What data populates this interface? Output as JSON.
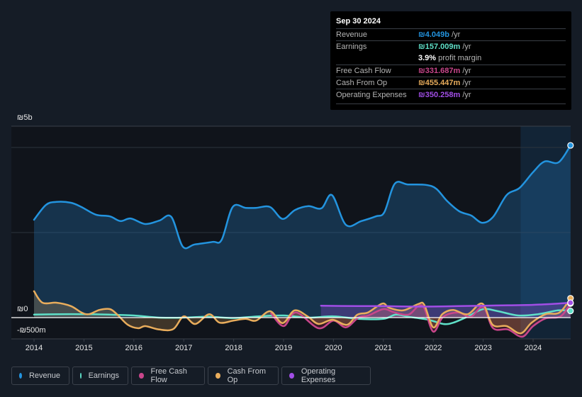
{
  "tooltip": {
    "date": "Sep 30 2024",
    "rows": [
      {
        "label": "Revenue",
        "value": "₪4.049b",
        "suffix": " /yr",
        "color": "#2394df"
      },
      {
        "label": "Earnings",
        "value": "₪157.009m",
        "suffix": " /yr",
        "color": "#5fe0c8"
      },
      {
        "label": "",
        "value": "3.9%",
        "suffix": " profit margin",
        "color": "#ffffff"
      },
      {
        "label": "Free Cash Flow",
        "value": "₪331.687m",
        "suffix": " /yr",
        "color": "#c9468b"
      },
      {
        "label": "Cash From Op",
        "value": "₪455.447m",
        "suffix": " /yr",
        "color": "#e9ad5c"
      },
      {
        "label": "Operating Expenses",
        "value": "₪350.258m",
        "suffix": " /yr",
        "color": "#a14ee6"
      }
    ]
  },
  "legend": [
    {
      "label": "Revenue",
      "color": "#2394df"
    },
    {
      "label": "Earnings",
      "color": "#5fe0c8"
    },
    {
      "label": "Free Cash Flow",
      "color": "#c9468b"
    },
    {
      "label": "Cash From Op",
      "color": "#e9ad5c"
    },
    {
      "label": "Operating Expenses",
      "color": "#a14ee6"
    }
  ],
  "chart_data": {
    "type": "line",
    "title": "",
    "xlabel": "",
    "ylabel": "",
    "y_unit": "billions ILS (₪)",
    "ylim": [
      -0.5,
      4.5
    ],
    "y_tick_labels": [
      "₪5b",
      "₪0",
      "-₪500m"
    ],
    "y_ticks": [
      5,
      0,
      -0.5
    ],
    "gridlines": [
      2,
      4
    ],
    "x_tick_labels": [
      "2014",
      "2015",
      "2016",
      "2017",
      "2018",
      "2019",
      "2020",
      "2021",
      "2022",
      "2023",
      "2024"
    ],
    "x_ticks": [
      2014,
      2015,
      2016,
      2017,
      2018,
      2019,
      2020,
      2021,
      2022,
      2023,
      2024
    ],
    "xlim": [
      2014,
      2024.75
    ],
    "highlight_from": 2023.75,
    "legend_position": "bottom-left",
    "series": [
      {
        "name": "Revenue",
        "color": "#2394df",
        "fill": true,
        "x": [
          2014.0,
          2014.24,
          2014.45,
          2014.74,
          2014.95,
          2015.24,
          2015.52,
          2015.73,
          2015.94,
          2016.23,
          2016.51,
          2016.75,
          2016.98,
          2017.22,
          2017.58,
          2017.76,
          2017.98,
          2018.24,
          2018.45,
          2018.73,
          2018.98,
          2019.23,
          2019.5,
          2019.76,
          2019.97,
          2020.25,
          2020.56,
          2020.85,
          2021.02,
          2021.23,
          2021.49,
          2021.85,
          2022.06,
          2022.27,
          2022.52,
          2022.76,
          2022.98,
          2023.2,
          2023.47,
          2023.73,
          2024.0,
          2024.23,
          2024.51,
          2024.75
        ],
        "values": [
          2.3,
          2.65,
          2.72,
          2.7,
          2.6,
          2.42,
          2.38,
          2.27,
          2.33,
          2.2,
          2.28,
          2.37,
          1.67,
          1.72,
          1.78,
          1.83,
          2.6,
          2.58,
          2.58,
          2.6,
          2.32,
          2.53,
          2.62,
          2.57,
          2.88,
          2.18,
          2.27,
          2.38,
          2.48,
          3.15,
          3.13,
          3.12,
          3.03,
          2.75,
          2.5,
          2.4,
          2.23,
          2.37,
          2.88,
          3.05,
          3.42,
          3.67,
          3.65,
          4.049
        ]
      },
      {
        "name": "Earnings",
        "color": "#5fe0c8",
        "fill": false,
        "x": [
          2014.0,
          2014.5,
          2015.0,
          2015.5,
          2016.0,
          2016.5,
          2017.0,
          2017.5,
          2018.0,
          2018.5,
          2019.0,
          2019.5,
          2020.0,
          2020.5,
          2021.0,
          2021.25,
          2021.5,
          2021.9,
          2022.2,
          2022.4,
          2022.7,
          2023.0,
          2023.3,
          2023.7,
          2024.1,
          2024.5,
          2024.75
        ],
        "values": [
          0.07,
          0.08,
          0.08,
          0.07,
          0.05,
          0.0,
          0.0,
          0.02,
          -0.01,
          0.03,
          0.05,
          0.0,
          0.03,
          -0.03,
          -0.03,
          0.07,
          0.02,
          -0.05,
          -0.15,
          -0.12,
          0.03,
          0.2,
          0.15,
          0.05,
          0.08,
          0.17,
          0.157
        ]
      },
      {
        "name": "Free Cash Flow",
        "color": "#c9468b",
        "fill": true,
        "x": [
          2018.75,
          2019.0,
          2019.25,
          2019.7,
          2020.0,
          2020.25,
          2020.5,
          2020.7,
          2021.0,
          2021.2,
          2021.5,
          2021.7,
          2021.82,
          2022.0,
          2022.2,
          2022.5,
          2022.75,
          2023.0,
          2023.2,
          2023.5,
          2023.78,
          2024.0,
          2024.25,
          2024.55,
          2024.75
        ],
        "values": [
          0.1,
          -0.2,
          0.12,
          -0.25,
          -0.07,
          -0.23,
          0.0,
          0.05,
          0.2,
          0.13,
          0.07,
          0.27,
          0.22,
          -0.33,
          0.02,
          0.12,
          0.02,
          0.25,
          -0.25,
          -0.28,
          -0.45,
          -0.2,
          -0.02,
          0.03,
          0.331687
        ]
      },
      {
        "name": "Cash From Op",
        "color": "#e9ad5c",
        "fill": true,
        "x": [
          2014.0,
          2014.17,
          2014.45,
          2014.74,
          2014.95,
          2015.1,
          2015.31,
          2015.52,
          2015.67,
          2015.88,
          2016.09,
          2016.23,
          2016.51,
          2016.79,
          2017.0,
          2017.23,
          2017.51,
          2017.72,
          2018.0,
          2018.24,
          2018.45,
          2018.73,
          2018.98,
          2019.22,
          2019.48,
          2019.7,
          2019.98,
          2020.27,
          2020.48,
          2020.69,
          2020.98,
          2021.12,
          2021.4,
          2021.7,
          2021.82,
          2022.0,
          2022.18,
          2022.4,
          2022.69,
          2022.98,
          2023.19,
          2023.47,
          2023.75,
          2023.97,
          2024.25,
          2024.53,
          2024.75
        ],
        "values": [
          0.62,
          0.35,
          0.35,
          0.27,
          0.12,
          0.08,
          0.18,
          0.2,
          0.07,
          -0.17,
          -0.25,
          -0.2,
          -0.28,
          -0.27,
          0.03,
          -0.15,
          0.08,
          -0.12,
          -0.07,
          -0.03,
          -0.07,
          0.15,
          -0.13,
          0.17,
          0.03,
          -0.15,
          -0.05,
          -0.17,
          0.07,
          0.12,
          0.33,
          0.23,
          0.17,
          0.32,
          0.3,
          -0.23,
          0.08,
          0.18,
          0.08,
          0.33,
          -0.17,
          -0.2,
          -0.37,
          -0.12,
          0.08,
          0.12,
          0.455447
        ]
      },
      {
        "name": "Operating Expenses",
        "color": "#a14ee6",
        "fill": true,
        "x": [
          2019.75,
          2020.5,
          2021.0,
          2021.5,
          2022.0,
          2022.5,
          2023.0,
          2023.5,
          2024.0,
          2024.5,
          2024.75
        ],
        "values": [
          0.28,
          0.27,
          0.27,
          0.26,
          0.26,
          0.27,
          0.28,
          0.29,
          0.3,
          0.33,
          0.350258
        ]
      }
    ]
  }
}
